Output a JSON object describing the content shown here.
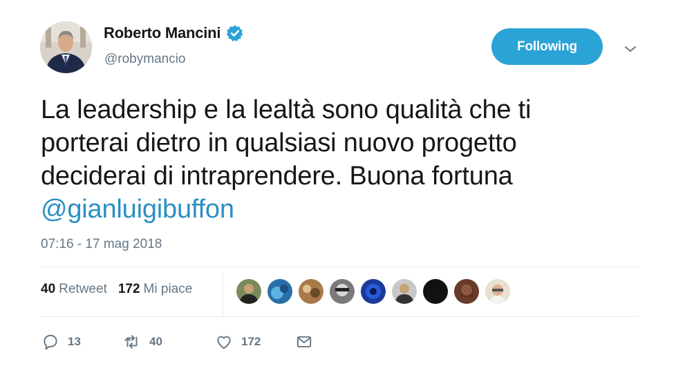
{
  "author": {
    "name": "Roberto Mancini",
    "handle": "@robymancio",
    "verified": true
  },
  "follow_button": {
    "label": "Following"
  },
  "tweet": {
    "lines": [
      "La leadership e la lealtà sono qualità che ti",
      "porterai dietro in qualsiasi nuovo progetto",
      "deciderai di intraprendere. Buona fortuna"
    ],
    "mention": "@gianluigibuffon",
    "timestamp": "07:16 - 17 mag 2018"
  },
  "stats": {
    "retweets_count": "40",
    "retweets_label": "Retweet",
    "likes_count": "172",
    "likes_label": "Mi piace"
  },
  "actions": {
    "reply_count": "13",
    "retweet_count": "40",
    "like_count": "172"
  },
  "colors": {
    "accent": "#2aa3d6",
    "mention": "#2b8fc4",
    "muted": "#657786"
  }
}
